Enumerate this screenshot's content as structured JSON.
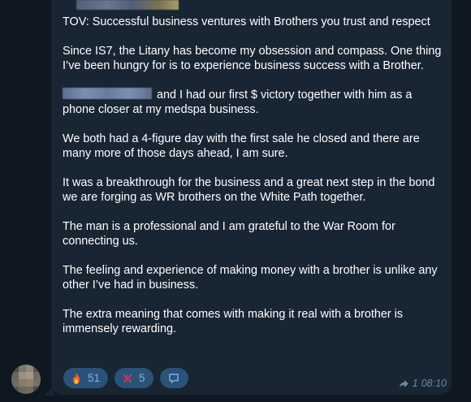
{
  "message": {
    "paragraphs": [
      "TOV: Successful business ventures with Brothers you trust and respect",
      "Since IS7, the Litany has become my obsession and compass. One thing I’ve been hungry for is to experience business success with a Brother.",
      "and I had our first $ victory together with him as a phone closer at my medspa business.",
      "We both had a 4-figure day with the first sale he closed and there are many more of those days ahead, I am sure.",
      "It was a breakthrough for the business and a great next step in the bond we are forging as WR brothers on the White Path together.",
      "The man is a professional and I am grateful to the War Room for connecting us.",
      "The feeling and experience of making money with a brother is unlike any other I’ve had in business.",
      "The extra meaning that comes with making it real with a brother is immensely rewarding."
    ],
    "reactions": [
      {
        "icon": "fire-icon",
        "count": "51"
      },
      {
        "icon": "sparkle-burst-icon",
        "count": "5"
      }
    ],
    "forwards": "1",
    "time": "08:10"
  },
  "colors": {
    "background": "#0f1821",
    "bubble": "#182533",
    "reaction_pill": "#2b5278",
    "reaction_text": "#7fb2e5",
    "meta_text": "#6d8aa3"
  }
}
